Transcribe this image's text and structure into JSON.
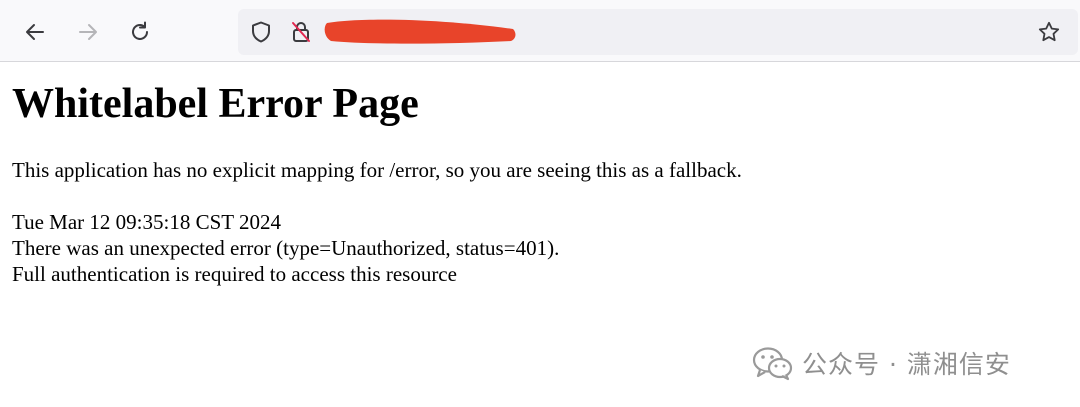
{
  "browser": {
    "back_icon": "arrow-left-icon",
    "forward_icon": "arrow-right-icon",
    "reload_icon": "reload-icon",
    "tracking_icon": "shield-icon",
    "security_icon": "lock-strikethrough-icon",
    "bookmark_icon": "star-icon",
    "redaction_color": "#e8442a"
  },
  "page": {
    "heading": "Whitelabel Error Page",
    "explanation": "This application has no explicit mapping for /error, so you are seeing this as a fallback.",
    "timestamp": "Tue Mar 12 09:35:18 CST 2024",
    "error_line": "There was an unexpected error (type=Unauthorized, status=401).",
    "error_detail": "Full authentication is required to access this resource"
  },
  "watermark": {
    "text": "公众号 · 潇湘信安"
  }
}
